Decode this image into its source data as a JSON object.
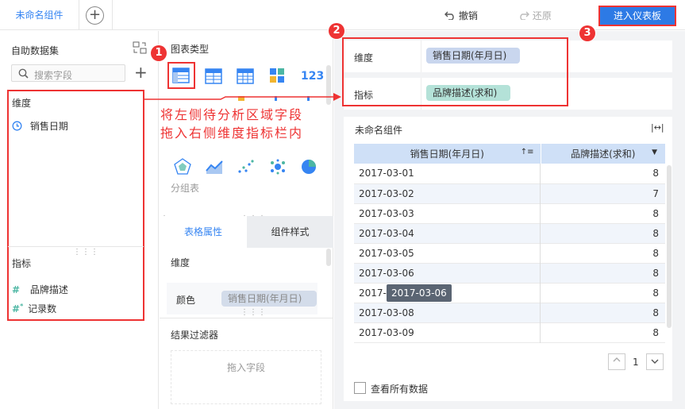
{
  "topbar": {
    "tab_label": "未命名组件",
    "add_tab_symbol": "+",
    "undo_label": "撤销",
    "redo_label": "还原",
    "enter_dashboard_label": "进入仪表板"
  },
  "left_panel": {
    "title": "自助数据集",
    "search_placeholder": "搜索字段",
    "dimension_title": "维度",
    "dimension_fields": [
      "销售日期"
    ],
    "indicator_title": "指标",
    "indicator_fields": [
      "品牌描述",
      "记录数"
    ]
  },
  "chart_panel": {
    "title": "图表类型",
    "group_table_label": "分组表",
    "tabs": [
      "表格属性",
      "组件样式"
    ],
    "dimension_label": "维度",
    "color_label": "颜色",
    "color_field": "销售日期(年月日)",
    "filter_title": "结果过滤器",
    "drop_hint": "拖入字段",
    "number_icon_text": "123"
  },
  "annotation": {
    "line1": "将左侧待分析区域字段",
    "line2": "拖入右侧维度指标栏内"
  },
  "badges": [
    "1",
    "2",
    "3"
  ],
  "slots": {
    "dimension_label": "维度",
    "dimension_chip": "销售日期(年月日)",
    "indicator_label": "指标",
    "indicator_chip": "品牌描述(求和)"
  },
  "widget": {
    "title": "未命名组件",
    "columns": [
      "销售日期(年月日)",
      "品牌描述(求和)"
    ],
    "rows": [
      [
        "2017-03-01",
        "8"
      ],
      [
        "2017-03-02",
        "7"
      ],
      [
        "2017-03-03",
        "8"
      ],
      [
        "2017-03-04",
        "8"
      ],
      [
        "2017-03-05",
        "8"
      ],
      [
        "2017-03-06",
        "8"
      ],
      [
        "2017-0",
        "8"
      ],
      [
        "2017-03-08",
        "8"
      ],
      [
        "2017-03-09",
        "8"
      ]
    ],
    "tooltip": "2017-03-06",
    "page": "1",
    "view_all_label": "查看所有数据"
  },
  "colors": {
    "accent": "#3685f2",
    "highlight_red": "#e33333",
    "dimension_chip": "#c9d6ee",
    "indicator_chip": "#b4e2d8",
    "header_blue": "#cfe0f7"
  }
}
